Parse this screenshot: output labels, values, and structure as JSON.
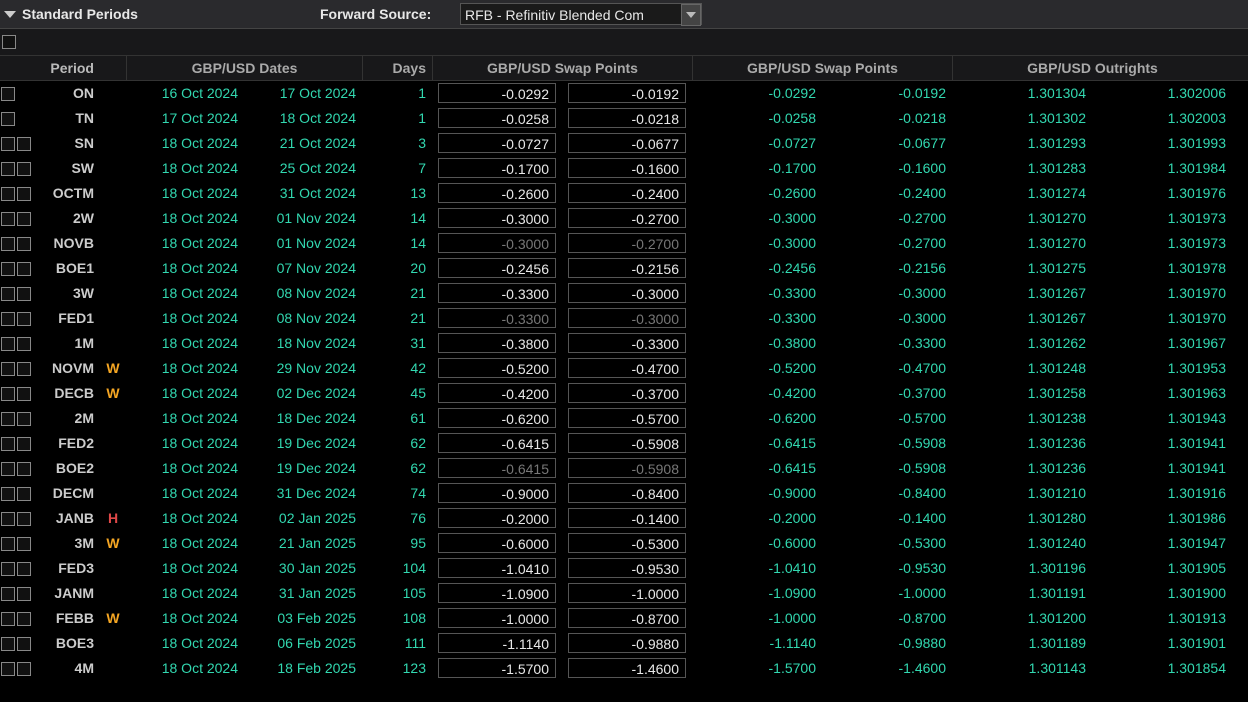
{
  "header": {
    "section_title": "Standard Periods",
    "forward_source_label": "Forward Source:",
    "forward_source_value": "RFB - Refinitiv Blended Com"
  },
  "columns": {
    "period": "Period",
    "dates": "GBP/USD Dates",
    "days": "Days",
    "swap1": "GBP/USD Swap Points",
    "swap2": "GBP/USD Swap Points",
    "outrights": "GBP/USD Outrights"
  },
  "rows": [
    {
      "period": "ON",
      "flag": "",
      "d1": "16 Oct 2024",
      "d2": "17 Oct 2024",
      "days": "1",
      "s1b": "-0.0292",
      "s1a": "-0.0192",
      "dim": false,
      "s2b": "-0.0292",
      "s2a": "-0.0192",
      "ob": "1.301304",
      "oa": "1.302006",
      "chk2": false
    },
    {
      "period": "TN",
      "flag": "",
      "d1": "17 Oct 2024",
      "d2": "18 Oct 2024",
      "days": "1",
      "s1b": "-0.0258",
      "s1a": "-0.0218",
      "dim": false,
      "s2b": "-0.0258",
      "s2a": "-0.0218",
      "ob": "1.301302",
      "oa": "1.302003",
      "chk2": false
    },
    {
      "period": "SN",
      "flag": "",
      "d1": "18 Oct 2024",
      "d2": "21 Oct 2024",
      "days": "3",
      "s1b": "-0.0727",
      "s1a": "-0.0677",
      "dim": false,
      "s2b": "-0.0727",
      "s2a": "-0.0677",
      "ob": "1.301293",
      "oa": "1.301993",
      "chk2": true
    },
    {
      "period": "SW",
      "flag": "",
      "d1": "18 Oct 2024",
      "d2": "25 Oct 2024",
      "days": "7",
      "s1b": "-0.1700",
      "s1a": "-0.1600",
      "dim": false,
      "s2b": "-0.1700",
      "s2a": "-0.1600",
      "ob": "1.301283",
      "oa": "1.301984",
      "chk2": true
    },
    {
      "period": "OCTM",
      "flag": "",
      "d1": "18 Oct 2024",
      "d2": "31 Oct 2024",
      "days": "13",
      "s1b": "-0.2600",
      "s1a": "-0.2400",
      "dim": false,
      "s2b": "-0.2600",
      "s2a": "-0.2400",
      "ob": "1.301274",
      "oa": "1.301976",
      "chk2": true
    },
    {
      "period": "2W",
      "flag": "",
      "d1": "18 Oct 2024",
      "d2": "01 Nov 2024",
      "days": "14",
      "s1b": "-0.3000",
      "s1a": "-0.2700",
      "dim": false,
      "s2b": "-0.3000",
      "s2a": "-0.2700",
      "ob": "1.301270",
      "oa": "1.301973",
      "chk2": true
    },
    {
      "period": "NOVB",
      "flag": "",
      "d1": "18 Oct 2024",
      "d2": "01 Nov 2024",
      "days": "14",
      "s1b": "-0.3000",
      "s1a": "-0.2700",
      "dim": true,
      "s2b": "-0.3000",
      "s2a": "-0.2700",
      "ob": "1.301270",
      "oa": "1.301973",
      "chk2": true
    },
    {
      "period": "BOE1",
      "flag": "",
      "d1": "18 Oct 2024",
      "d2": "07 Nov 2024",
      "days": "20",
      "s1b": "-0.2456",
      "s1a": "-0.2156",
      "dim": false,
      "s2b": "-0.2456",
      "s2a": "-0.2156",
      "ob": "1.301275",
      "oa": "1.301978",
      "chk2": true
    },
    {
      "period": "3W",
      "flag": "",
      "d1": "18 Oct 2024",
      "d2": "08 Nov 2024",
      "days": "21",
      "s1b": "-0.3300",
      "s1a": "-0.3000",
      "dim": false,
      "s2b": "-0.3300",
      "s2a": "-0.3000",
      "ob": "1.301267",
      "oa": "1.301970",
      "chk2": true
    },
    {
      "period": "FED1",
      "flag": "",
      "d1": "18 Oct 2024",
      "d2": "08 Nov 2024",
      "days": "21",
      "s1b": "-0.3300",
      "s1a": "-0.3000",
      "dim": true,
      "s2b": "-0.3300",
      "s2a": "-0.3000",
      "ob": "1.301267",
      "oa": "1.301970",
      "chk2": true
    },
    {
      "period": "1M",
      "flag": "",
      "d1": "18 Oct 2024",
      "d2": "18 Nov 2024",
      "days": "31",
      "s1b": "-0.3800",
      "s1a": "-0.3300",
      "dim": false,
      "s2b": "-0.3800",
      "s2a": "-0.3300",
      "ob": "1.301262",
      "oa": "1.301967",
      "chk2": true
    },
    {
      "period": "NOVM",
      "flag": "W",
      "d1": "18 Oct 2024",
      "d2": "29 Nov 2024",
      "days": "42",
      "s1b": "-0.5200",
      "s1a": "-0.4700",
      "dim": false,
      "s2b": "-0.5200",
      "s2a": "-0.4700",
      "ob": "1.301248",
      "oa": "1.301953",
      "chk2": true
    },
    {
      "period": "DECB",
      "flag": "W",
      "d1": "18 Oct 2024",
      "d2": "02 Dec 2024",
      "days": "45",
      "s1b": "-0.4200",
      "s1a": "-0.3700",
      "dim": false,
      "s2b": "-0.4200",
      "s2a": "-0.3700",
      "ob": "1.301258",
      "oa": "1.301963",
      "chk2": true
    },
    {
      "period": "2M",
      "flag": "",
      "d1": "18 Oct 2024",
      "d2": "18 Dec 2024",
      "days": "61",
      "s1b": "-0.6200",
      "s1a": "-0.5700",
      "dim": false,
      "s2b": "-0.6200",
      "s2a": "-0.5700",
      "ob": "1.301238",
      "oa": "1.301943",
      "chk2": true
    },
    {
      "period": "FED2",
      "flag": "",
      "d1": "18 Oct 2024",
      "d2": "19 Dec 2024",
      "days": "62",
      "s1b": "-0.6415",
      "s1a": "-0.5908",
      "dim": false,
      "s2b": "-0.6415",
      "s2a": "-0.5908",
      "ob": "1.301236",
      "oa": "1.301941",
      "chk2": true
    },
    {
      "period": "BOE2",
      "flag": "",
      "d1": "18 Oct 2024",
      "d2": "19 Dec 2024",
      "days": "62",
      "s1b": "-0.6415",
      "s1a": "-0.5908",
      "dim": true,
      "s2b": "-0.6415",
      "s2a": "-0.5908",
      "ob": "1.301236",
      "oa": "1.301941",
      "chk2": true
    },
    {
      "period": "DECM",
      "flag": "",
      "d1": "18 Oct 2024",
      "d2": "31 Dec 2024",
      "days": "74",
      "s1b": "-0.9000",
      "s1a": "-0.8400",
      "dim": false,
      "s2b": "-0.9000",
      "s2a": "-0.8400",
      "ob": "1.301210",
      "oa": "1.301916",
      "chk2": true
    },
    {
      "period": "JANB",
      "flag": "H",
      "d1": "18 Oct 2024",
      "d2": "02 Jan 2025",
      "days": "76",
      "s1b": "-0.2000",
      "s1a": "-0.1400",
      "dim": false,
      "s2b": "-0.2000",
      "s2a": "-0.1400",
      "ob": "1.301280",
      "oa": "1.301986",
      "chk2": true
    },
    {
      "period": "3M",
      "flag": "W",
      "d1": "18 Oct 2024",
      "d2": "21 Jan 2025",
      "days": "95",
      "s1b": "-0.6000",
      "s1a": "-0.5300",
      "dim": false,
      "s2b": "-0.6000",
      "s2a": "-0.5300",
      "ob": "1.301240",
      "oa": "1.301947",
      "chk2": true
    },
    {
      "period": "FED3",
      "flag": "",
      "d1": "18 Oct 2024",
      "d2": "30 Jan 2025",
      "days": "104",
      "s1b": "-1.0410",
      "s1a": "-0.9530",
      "dim": false,
      "s2b": "-1.0410",
      "s2a": "-0.9530",
      "ob": "1.301196",
      "oa": "1.301905",
      "chk2": true
    },
    {
      "period": "JANM",
      "flag": "",
      "d1": "18 Oct 2024",
      "d2": "31 Jan 2025",
      "days": "105",
      "s1b": "-1.0900",
      "s1a": "-1.0000",
      "dim": false,
      "s2b": "-1.0900",
      "s2a": "-1.0000",
      "ob": "1.301191",
      "oa": "1.301900",
      "chk2": true
    },
    {
      "period": "FEBB",
      "flag": "W",
      "d1": "18 Oct 2024",
      "d2": "03 Feb 2025",
      "days": "108",
      "s1b": "-1.0000",
      "s1a": "-0.8700",
      "dim": false,
      "s2b": "-1.0000",
      "s2a": "-0.8700",
      "ob": "1.301200",
      "oa": "1.301913",
      "chk2": true
    },
    {
      "period": "BOE3",
      "flag": "",
      "d1": "18 Oct 2024",
      "d2": "06 Feb 2025",
      "days": "111",
      "s1b": "-1.1140",
      "s1a": "-0.9880",
      "dim": false,
      "s2b": "-1.1140",
      "s2a": "-0.9880",
      "ob": "1.301189",
      "oa": "1.301901",
      "chk2": true
    },
    {
      "period": "4M",
      "flag": "",
      "d1": "18 Oct 2024",
      "d2": "18 Feb 2025",
      "days": "123",
      "s1b": "-1.5700",
      "s1a": "-1.4600",
      "dim": false,
      "s2b": "-1.5700",
      "s2a": "-1.4600",
      "ob": "1.301143",
      "oa": "1.301854",
      "chk2": true
    }
  ]
}
